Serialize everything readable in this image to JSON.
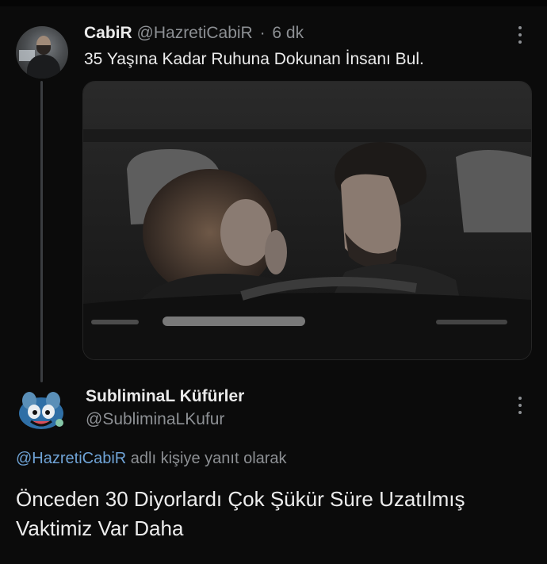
{
  "original_tweet": {
    "author_name": "CabiR",
    "author_handle": "@HazretiCabiR",
    "separator": "·",
    "time": "6 dk",
    "text": "35 Yaşına Kadar Ruhuna Dokunan İnsanı Bul.",
    "avatar_icon": "user-avatar-photo",
    "media_description_icon": "photo-media"
  },
  "reply_tweet": {
    "author_name": "SubliminaL Küfürler",
    "author_handle": "@SubliminaLKufur",
    "avatar_icon": "cartoon-character-avatar",
    "reply_to_mention": "@HazretiCabiR",
    "reply_to_suffix": " adlı kişiye yanıt olarak",
    "text_lines": [
      "Önceden 30 Diyorlardı Çok Şükür Süre Uzatılmış",
      "Vaktimiz Var Daha"
    ]
  },
  "colors": {
    "background": "#0b0b0b",
    "text_primary": "#e7e9ea",
    "text_secondary": "#8d9094",
    "link": "#6fa3d6"
  }
}
